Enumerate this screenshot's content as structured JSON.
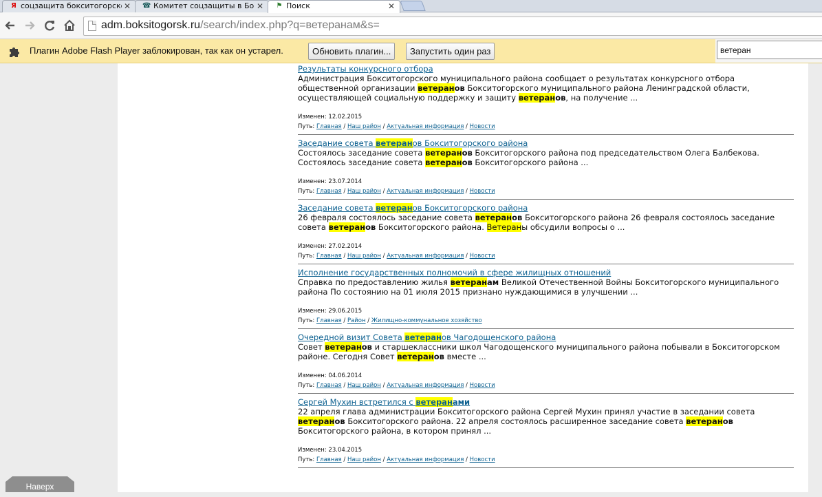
{
  "tabs": [
    {
      "icon": "Я",
      "title": "соцзащита бокситогорског",
      "active": false
    },
    {
      "icon": "☎",
      "title": "Комитет соцзащиты в Бокс",
      "active": false
    },
    {
      "icon": "⚑",
      "title": "Поиск",
      "active": true
    }
  ],
  "toolbar": {
    "url_host": "adm.boksitogorsk.ru",
    "url_rest": "/search/index.php?q=ветеранам&s="
  },
  "infobar": {
    "message": "Плагин Adobe Flash Player заблокирован, так как он устарел.",
    "update_button": "Обновить плагин...",
    "run_once_button": "Запустить один раз"
  },
  "find": {
    "value": "ветеран"
  },
  "results": [
    {
      "title": [
        {
          "t": "Результаты конкурсного отбора"
        }
      ],
      "snippet": [
        {
          "t": "Администрация Бокситогорского муниципального района сообщает о результатах конкурсного отбора общественной организации "
        },
        {
          "t": "ветеран",
          "hl": true
        },
        {
          "t": "ов",
          "b": true
        },
        {
          "t": " Бокситогорского муниципального района Ленинградской области, осуществляющей социальную поддержку и защиту "
        },
        {
          "t": "ветеран",
          "hl": true
        },
        {
          "t": "ов",
          "b": true
        },
        {
          "t": ", на получение ..."
        }
      ],
      "changed": "Изменен: 12.02.2015",
      "path": [
        "Главная",
        "Наш район",
        "Актуальная информация",
        "Новости"
      ]
    },
    {
      "title": [
        {
          "t": "Заседание совета "
        },
        {
          "t": "ветеран",
          "hl": true
        },
        {
          "t": "ов Бокситогорского района"
        }
      ],
      "snippet": [
        {
          "t": "Состоялось заседание совета "
        },
        {
          "t": "ветеран",
          "hl": true
        },
        {
          "t": "ов",
          "b": true
        },
        {
          "t": " Бокситогорского района под председательством Олега Балбекова. Состоялось заседание совета "
        },
        {
          "t": "ветеран",
          "hl": true
        },
        {
          "t": "ов",
          "b": true
        },
        {
          "t": " Бокситогорского района ..."
        }
      ],
      "changed": "Изменен: 23.07.2014",
      "path": [
        "Главная",
        "Наш район",
        "Актуальная информация",
        "Новости"
      ]
    },
    {
      "title": [
        {
          "t": "Заседание совета "
        },
        {
          "t": "ветеран",
          "hl": true
        },
        {
          "t": "ов Бокситогорского района"
        }
      ],
      "snippet": [
        {
          "t": "26 февраля состоялось заседание совета "
        },
        {
          "t": "ветеран",
          "hl": true
        },
        {
          "t": "ов",
          "b": true
        },
        {
          "t": " Бокситогорского района 26 февраля состоялось заседание совета "
        },
        {
          "t": "ветеран",
          "hl": true
        },
        {
          "t": "ов",
          "b": true
        },
        {
          "t": " Бокситогорского района. "
        },
        {
          "t": "Ветеран",
          "hlplain": true
        },
        {
          "t": "ы обсудили вопросы о ..."
        }
      ],
      "changed": "Изменен: 27.02.2014",
      "path": [
        "Главная",
        "Наш район",
        "Актуальная информация",
        "Новости"
      ]
    },
    {
      "title": [
        {
          "t": "Исполнение государственных полномочий в сфере жилищных отношений"
        }
      ],
      "snippet": [
        {
          "t": "Справка по предоставлению жилья "
        },
        {
          "t": "ветеран",
          "hl": true
        },
        {
          "t": "ам",
          "b": true
        },
        {
          "t": " Великой Отечественной Войны Бокситогорского муниципального района По состоянию на 01 июля 2015 признано нуждающимися в улучшении ..."
        }
      ],
      "changed": "Изменен: 29.06.2015",
      "path": [
        "Главная",
        "Район",
        "Жилищно-коммунальное хозяйство"
      ]
    },
    {
      "title": [
        {
          "t": "Очередной визит Совета "
        },
        {
          "t": "ветеран",
          "hl": true
        },
        {
          "t": "ов Чагодощенского района"
        }
      ],
      "snippet": [
        {
          "t": "Совет "
        },
        {
          "t": "ветеран",
          "hl": true
        },
        {
          "t": "ов",
          "b": true
        },
        {
          "t": " и старшеклассники школ Чагодощенского муниципального района побывали в Бокситогорском районе. Сегодня Совет "
        },
        {
          "t": "ветеран",
          "hl": true
        },
        {
          "t": "ов",
          "b": true
        },
        {
          "t": " вместе ..."
        }
      ],
      "changed": "Изменен: 04.06.2014",
      "path": [
        "Главная",
        "Наш район",
        "Актуальная информация",
        "Новости"
      ]
    },
    {
      "title": [
        {
          "t": "Сергей Мухин встретился с "
        },
        {
          "t": "ветеран",
          "hl": true
        },
        {
          "t": "ами",
          "b": true
        }
      ],
      "snippet": [
        {
          "t": "22 апреля глава администрации Бокситогорского района Сергей Мухин принял участие в заседании совета "
        },
        {
          "t": "ветеран",
          "hl": true
        },
        {
          "t": "ов",
          "b": true
        },
        {
          "t": " Бокситогорского района. 22 апреля состоялось расширенное заседание совета "
        },
        {
          "t": "ветеран",
          "hl": true
        },
        {
          "t": "ов",
          "b": true
        },
        {
          "t": " Бокситогорского района, в котором принял ..."
        }
      ],
      "changed": "Изменен: 23.04.2015",
      "path": [
        "Главная",
        "Наш район",
        "Актуальная информация",
        "Новости"
      ]
    }
  ],
  "navverh_label": "Наверх"
}
